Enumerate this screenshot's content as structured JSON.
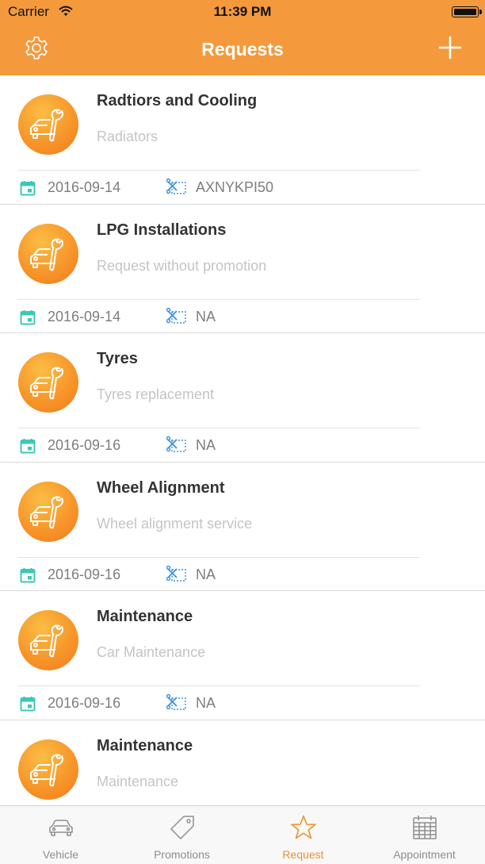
{
  "status_bar": {
    "carrier": "Carrier",
    "time": "11:39 PM"
  },
  "header": {
    "title": "Requests",
    "left_icon": "gear-icon",
    "right_icon": "plus-icon"
  },
  "requests": [
    {
      "title": "Radtiors and Cooling",
      "description": "Radiators",
      "date": "2016-09-14",
      "coupon": "AXNYKPI50"
    },
    {
      "title": "LPG Installations",
      "description": "Request without promotion",
      "date": "2016-09-14",
      "coupon": "NA"
    },
    {
      "title": "Tyres",
      "description": "Tyres replacement",
      "date": "2016-09-16",
      "coupon": "NA"
    },
    {
      "title": "Wheel Alignment",
      "description": "Wheel alignment service",
      "date": "2016-09-16",
      "coupon": "NA"
    },
    {
      "title": "Maintenance",
      "description": "Car Maintenance",
      "date": "2016-09-16",
      "coupon": "NA"
    },
    {
      "title": "Maintenance",
      "description": "Maintenance",
      "date": "",
      "coupon": ""
    }
  ],
  "tabs": [
    {
      "label": "Vehicle",
      "icon": "car-icon"
    },
    {
      "label": "Promotions",
      "icon": "tag-icon"
    },
    {
      "label": "Request",
      "icon": "star-icon",
      "active": true
    },
    {
      "label": "Appointment",
      "icon": "calendar-icon"
    }
  ],
  "colors": {
    "accent": "#f49a3c",
    "icon_teal": "#3bc8b7",
    "coupon_blue": "#3c8ee0",
    "tab_active": "#f0902e"
  }
}
